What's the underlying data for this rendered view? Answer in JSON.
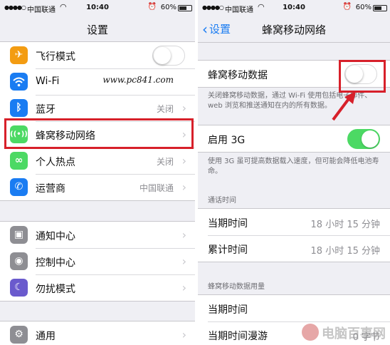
{
  "colors": {
    "ios_blue": "#1a7cf2",
    "toggle_on": "#4cd964",
    "highlight_red": "#d7202a",
    "group_bg": "#efeff4"
  },
  "left": {
    "status": {
      "carrier": "中国联通",
      "time": "10:40",
      "battery": "60%"
    },
    "nav_title": "设置",
    "group1": [
      {
        "label": "飞行模式",
        "icon": "airplane-icon",
        "icon_glyph": "✈",
        "icon_color": "#f39c12",
        "toggle": false
      },
      {
        "label": "Wi-Fi",
        "icon": "wifi-icon",
        "icon_glyph": "≋",
        "icon_color": "#1a7cf2",
        "value": "www.pc841.com"
      },
      {
        "label": "蓝牙",
        "icon": "bluetooth-icon",
        "icon_glyph": "ᛒ",
        "icon_color": "#1a7cf2",
        "value": "关闭"
      },
      {
        "label": "蜂窝移动网络",
        "icon": "cellular-icon",
        "icon_glyph": "((•))",
        "icon_color": "#4cd964"
      },
      {
        "label": "个人热点",
        "icon": "hotspot-icon",
        "icon_glyph": "∞",
        "icon_color": "#4cd964",
        "value": "关闭"
      },
      {
        "label": "运营商",
        "icon": "phone-icon",
        "icon_glyph": "✆",
        "icon_color": "#1a7cf2",
        "value": "中国联通"
      }
    ],
    "group2": [
      {
        "label": "通知中心",
        "icon": "notification-center-icon",
        "icon_glyph": "▣",
        "icon_color": "#8e8e93"
      },
      {
        "label": "控制中心",
        "icon": "control-center-icon",
        "icon_glyph": "◉",
        "icon_color": "#8e8e93"
      },
      {
        "label": "勿扰模式",
        "icon": "moon-icon",
        "icon_glyph": "☾",
        "icon_color": "#6a5acd"
      }
    ],
    "group3": [
      {
        "label": "通用",
        "icon": "gear-icon",
        "icon_glyph": "⚙",
        "icon_color": "#8e8e93"
      }
    ]
  },
  "right": {
    "status": {
      "carrier": "中国联通",
      "time": "10:40",
      "battery": "60%"
    },
    "back_label": "设置",
    "nav_title": "蜂窝移动网络",
    "cellular_data": {
      "label": "蜂窝移动数据",
      "toggle": false
    },
    "cellular_note": "关闭蜂窝移动数据，通过 Wi-Fi 使用包括电子邮件、web 浏览和推送通知在内的所有数据。",
    "enable_3g": {
      "label": "启用 3G",
      "toggle": true
    },
    "enable_3g_note": "使用 3G 虽可提高数据载入速度，但可能会降低电池寿命。",
    "call_time_header": "通话时间",
    "call_time": [
      {
        "label": "当期时间",
        "value": "18 小时 15 分钟"
      },
      {
        "label": "累计时间",
        "value": "18 小时 15 分钟"
      }
    ],
    "usage_header": "蜂窝移动数据用量",
    "usage": [
      {
        "label": "当期时间",
        "value": ""
      },
      {
        "label": "当期时间漫游",
        "value": "0 字节"
      }
    ]
  },
  "watermark": "电脑百事网"
}
